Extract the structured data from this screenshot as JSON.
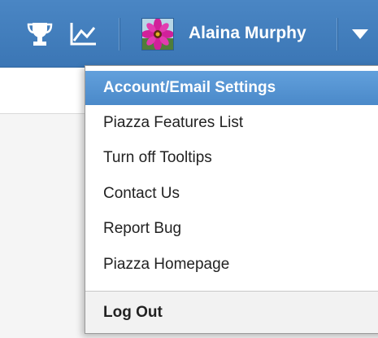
{
  "header": {
    "user_name": "Alaina Murphy",
    "icons": [
      "trophy-icon",
      "graph-icon",
      "flower-avatar",
      "caret-down-icon"
    ],
    "bar_color": "#4080c0"
  },
  "menu": {
    "items": [
      {
        "label": "Account/Email Settings",
        "active": true
      },
      {
        "label": "Piazza Features List"
      },
      {
        "label": "Turn off Tooltips"
      },
      {
        "label": "Contact Us"
      },
      {
        "label": "Report Bug"
      },
      {
        "label": "Piazza Homepage"
      }
    ],
    "logout_label": "Log Out",
    "highlight_color": "#5596d6"
  }
}
